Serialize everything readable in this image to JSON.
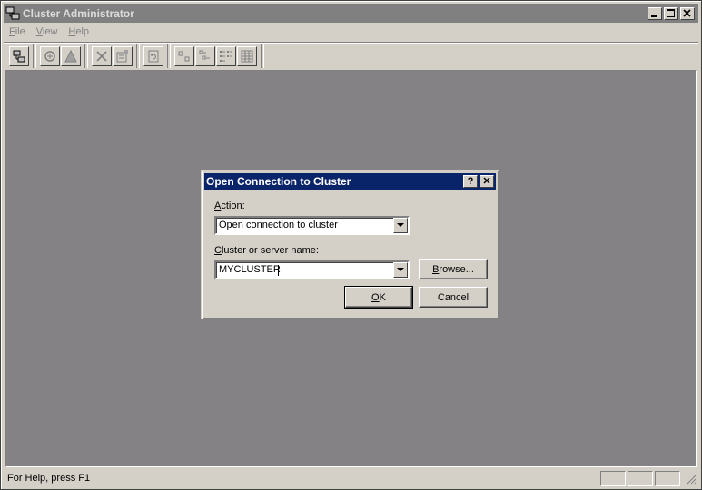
{
  "window": {
    "title": "Cluster Administrator"
  },
  "menu": [
    {
      "key": "F",
      "rest": "ile"
    },
    {
      "key": "V",
      "rest": "iew"
    },
    {
      "key": "H",
      "rest": "elp"
    }
  ],
  "toolbar": {
    "icons": [
      "connect-cluster-icon",
      "bring-online-icon",
      "take-offline-icon",
      "delete-icon",
      "properties-icon",
      "refresh-icon",
      "large-icons-view-icon",
      "small-icons-view-icon",
      "list-view-icon",
      "details-view-icon"
    ]
  },
  "dialog": {
    "title": "Open Connection to Cluster",
    "help_glyph": "?",
    "close_glyph": "✕",
    "action_label_key": "A",
    "action_label_rest": "ction:",
    "action_value": "Open connection to cluster",
    "server_label_key": "C",
    "server_label_rest": "luster or server name:",
    "server_value": "MYCLUSTER",
    "browse_key": "B",
    "browse_rest": "rowse...",
    "ok_key": "O",
    "ok_rest": "K",
    "cancel_label": "Cancel"
  },
  "status": {
    "text": "For Help, press F1"
  }
}
